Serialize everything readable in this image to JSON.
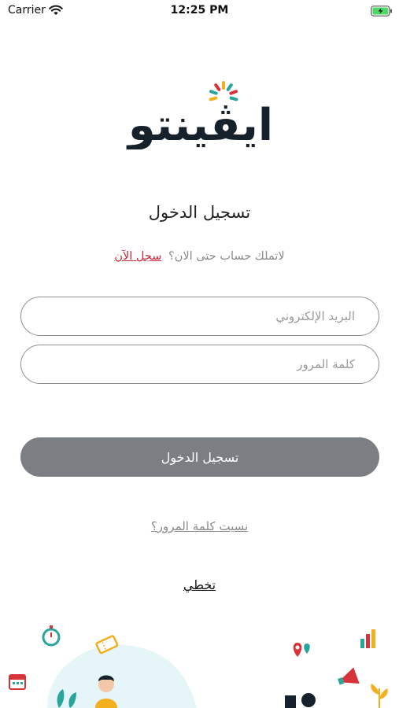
{
  "status_bar": {
    "carrier": "Carrier",
    "time": "12:25 PM",
    "icons": [
      "wifi-icon",
      "battery-charging-icon"
    ]
  },
  "brand": {
    "logo_text": "ايڤينتو",
    "colors": {
      "text": "#16212b",
      "red": "#d6333b",
      "teal": "#2aa59b",
      "yellow": "#f2b01e"
    }
  },
  "login": {
    "title": "تسجيل الدخول",
    "signup_question": "لاتملك حساب حتى الان؟",
    "signup_link": "سجل الآن",
    "email_placeholder": "البريد الإلكتروني",
    "email_value": "",
    "password_placeholder": "كلمة المرور",
    "password_value": "",
    "submit_label": "تسجيل الدخول",
    "forgot_password": "نسيت كلمة المرور؟",
    "skip": "تخطي"
  },
  "colors": {
    "button_bg": "#7b7f84",
    "link_red": "#c62835",
    "field_border": "#8f8f8f"
  },
  "illustration": {
    "icons": [
      "stopwatch-icon",
      "calendar-icon",
      "tickets-icon",
      "person-icon",
      "leaf-icon",
      "location-pin-icon",
      "bar-chart-icon",
      "megaphone-icon",
      "plant-icon"
    ]
  }
}
